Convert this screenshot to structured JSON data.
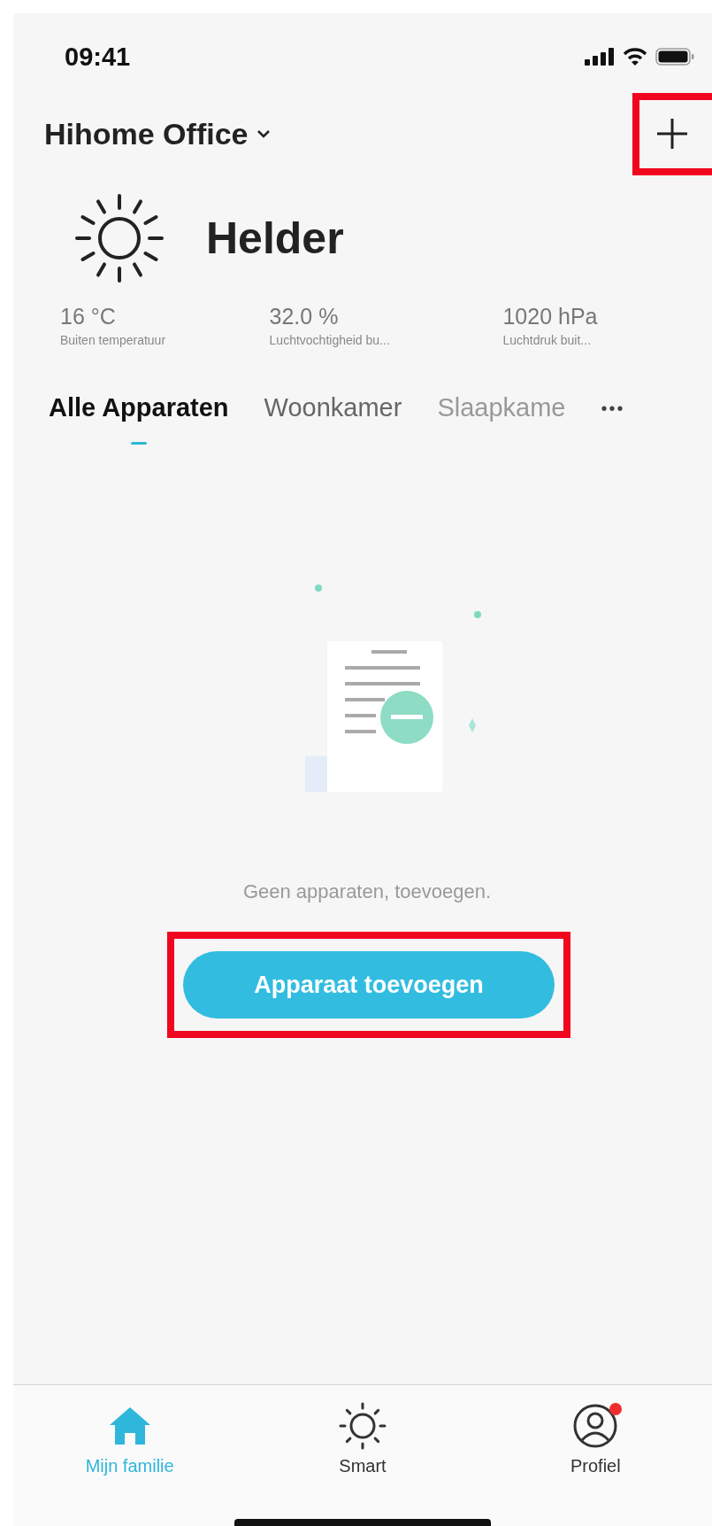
{
  "status_bar": {
    "time": "09:41"
  },
  "header": {
    "home_name": "Hihome Office"
  },
  "weather": {
    "condition": "Helder",
    "stats": [
      {
        "value": "16 °C",
        "label": "Buiten temperatuur"
      },
      {
        "value": "32.0 %",
        "label": "Luchtvochtigheid bu..."
      },
      {
        "value": "1020 hPa",
        "label": "Luchtdruk buit..."
      }
    ]
  },
  "tabs": [
    {
      "label": "Alle Apparaten",
      "selected": true
    },
    {
      "label": "Woonkamer",
      "selected": false
    },
    {
      "label": "Slaapkame",
      "selected": false
    }
  ],
  "tabs_more": "•••",
  "empty_state": {
    "message": "Geen apparaten, toevoegen.",
    "button": "Apparaat toevoegen"
  },
  "nav": [
    {
      "kind": "home",
      "label": "Mijn familie",
      "selected": true,
      "badge": false
    },
    {
      "kind": "smart",
      "label": "Smart",
      "selected": false,
      "badge": false
    },
    {
      "kind": "profile",
      "label": "Profiel",
      "selected": false,
      "badge": true
    }
  ]
}
